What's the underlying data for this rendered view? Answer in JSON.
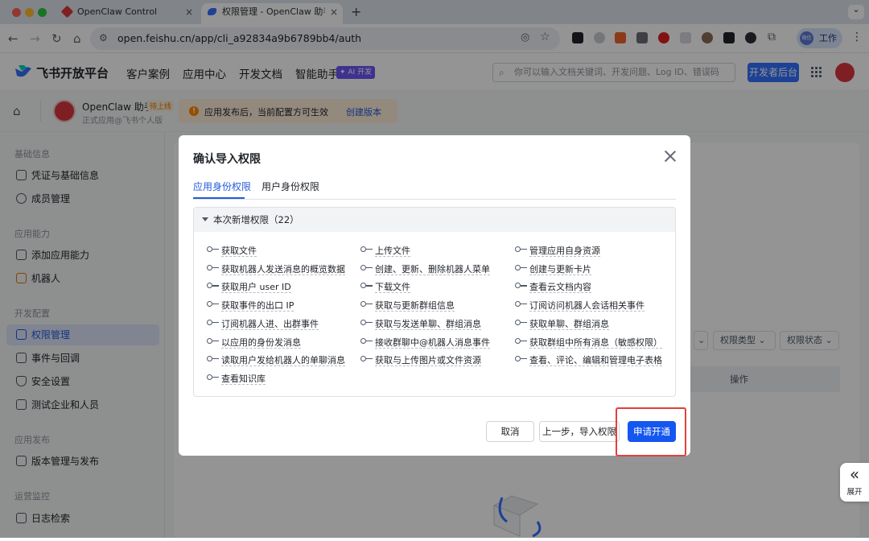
{
  "browser": {
    "tabs": [
      {
        "title": "OpenClaw Control",
        "close": "×"
      },
      {
        "title": "权限管理 - OpenClaw 助手 - 开",
        "close": "×"
      }
    ],
    "new_tab": "+",
    "url": "open.feishu.cn/app/cli_a92834a9b6789bb4/auth",
    "profile_label": "工作",
    "profile_avatar": "微信",
    "menu": "⋮",
    "tab_list": "⌄"
  },
  "header": {
    "brand": "飞书开放平台",
    "nav": [
      "客户案例",
      "应用中心",
      "开发文档",
      "智能助手"
    ],
    "ai_badge": "✦ AI 开发",
    "search_placeholder": "你可以输入文档关键词、开发问题、Log ID、错误码",
    "dev_console": "开发者后台"
  },
  "app": {
    "name": "OpenClaw 助手",
    "status": "待上线",
    "subtitle": "正式应用@飞书个人版",
    "notice": "应用发布后，当前配置方可生效",
    "create_version": "创建版本"
  },
  "sidebar": {
    "groups": [
      {
        "title": "基础信息",
        "items": [
          "凭证与基础信息",
          "成员管理"
        ]
      },
      {
        "title": "应用能力",
        "items": [
          "添加应用能力",
          "机器人"
        ]
      },
      {
        "title": "开发配置",
        "items": [
          "权限管理",
          "事件与回调",
          "安全设置",
          "测试企业和人员"
        ]
      },
      {
        "title": "应用发布",
        "items": [
          "版本管理与发布"
        ]
      },
      {
        "title": "运营监控",
        "items": [
          "日志检索"
        ]
      }
    ],
    "active": "权限管理"
  },
  "background": {
    "filters": [
      "权限类型",
      "权限状态"
    ],
    "col_header": "操作"
  },
  "modal": {
    "title": "确认导入权限",
    "tabs": [
      "应用身份权限",
      "用户身份权限"
    ],
    "section": "本次新增权限（22）",
    "permissions": [
      [
        "获取文件",
        "上传文件",
        "管理应用自身资源"
      ],
      [
        "获取机器人发送消息的概览数据",
        "创建、更新、删除机器人菜单",
        "创建与更新卡片"
      ],
      [
        "获取用户 user ID",
        "下载文件",
        "查看云文档内容"
      ],
      [
        "获取事件的出口 IP",
        "获取与更新群组信息",
        "订阅访问机器人会话相关事件"
      ],
      [
        "订阅机器人进、出群事件",
        "获取与发送单聊、群组消息",
        "获取单聊、群组消息"
      ],
      [
        "以应用的身份发消息",
        "接收群聊中@机器人消息事件",
        "获取群组中所有消息（敏感权限）"
      ],
      [
        "读取用户发给机器人的单聊消息",
        "获取与上传图片或文件资源",
        "查看、评论、编辑和管理电子表格"
      ],
      [
        "查看知识库"
      ]
    ],
    "buttons": {
      "cancel": "取消",
      "prev": "上一步，导入权限",
      "apply": "申请开通"
    }
  },
  "expand": {
    "arrow": "«",
    "label": "展开"
  },
  "colors": {
    "primary": "#1456f0",
    "highlight": "#e0413b",
    "warning": "#ff8800"
  }
}
